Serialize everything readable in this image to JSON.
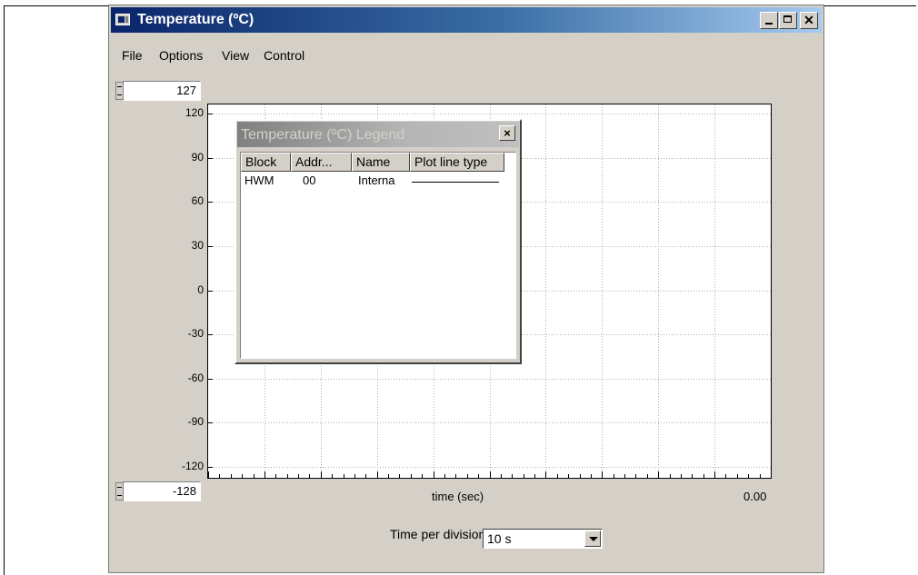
{
  "window": {
    "title": "Temperature (ºC)",
    "controls": {
      "minimize": "_",
      "maximize": "□",
      "close": "✕"
    },
    "icon": "app-window-icon"
  },
  "menu": [
    "File",
    "Options",
    "View",
    "Control"
  ],
  "y_max_input": "127",
  "y_min_input": "-128",
  "x_axis": {
    "label": "time (sec)",
    "end_value": "0.00"
  },
  "time_per_division": {
    "label": "Time per division:",
    "value": "10 s"
  },
  "legend": {
    "title": "Temperature (ºC) Legend",
    "close": "×",
    "columns": [
      "Block",
      "Addr...",
      "Name",
      "Plot line type"
    ],
    "rows": [
      {
        "block": "HWM",
        "addr": "00",
        "name": "Interna"
      }
    ]
  },
  "chart_data": {
    "type": "line",
    "y_ticks": [
      120,
      90,
      60,
      30,
      0,
      -30,
      -60,
      -90,
      -120
    ],
    "ylim": [
      -128,
      127
    ],
    "x_divisions": 10,
    "grid": true,
    "xlabel": "time (sec)",
    "series": []
  }
}
